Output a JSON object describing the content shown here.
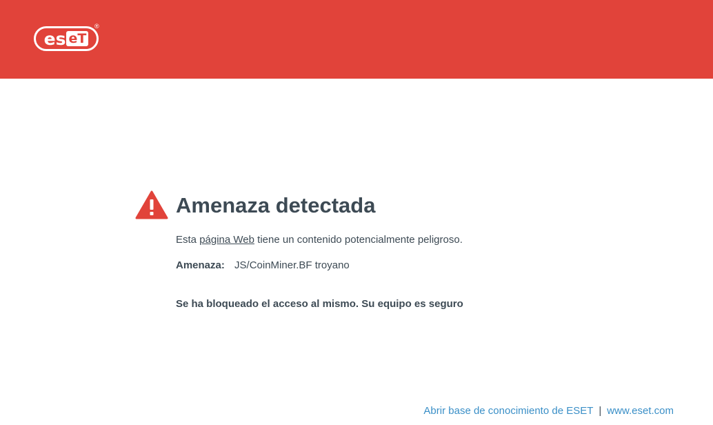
{
  "brand": {
    "logo_text_es": "es",
    "logo_text_et": "eT",
    "registered": "®",
    "header_color": "#e1433a"
  },
  "alert": {
    "icon": "warning-triangle-icon",
    "title": "Amenaza detectada",
    "desc_prefix": "Esta ",
    "desc_link": "página Web",
    "desc_suffix": " tiene un contenido potencialmente peligroso.",
    "threat_label": "Amenaza:",
    "threat_value": "JS/CoinMiner.BF troyano",
    "blocked_message": "Se ha bloqueado el acceso al mismo. Su equipo es seguro"
  },
  "footer": {
    "kb_link": "Abrir base de conocimiento de ESET",
    "separator": "|",
    "site_link": "www.eset.com",
    "link_color": "#3a8fc7"
  }
}
